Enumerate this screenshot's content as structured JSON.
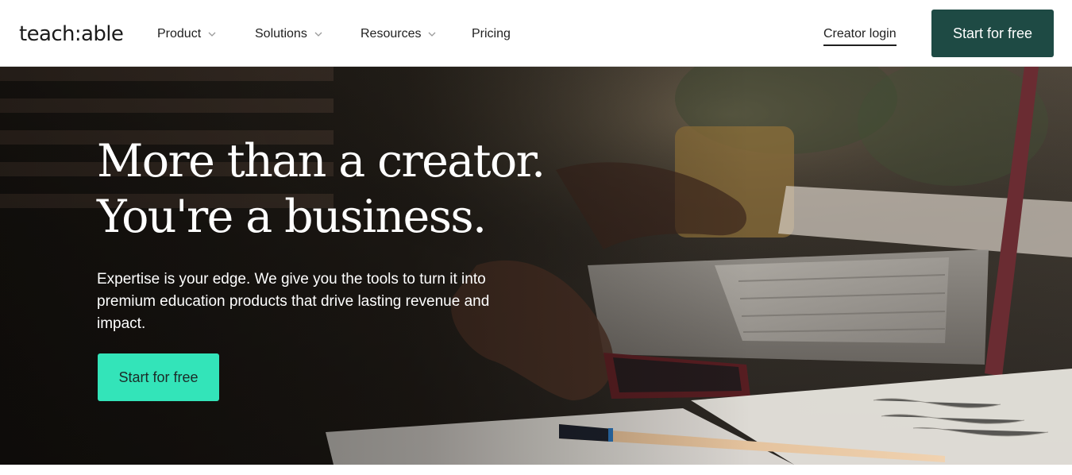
{
  "header": {
    "logo_text": "teach:able",
    "nav": [
      {
        "label": "Product",
        "has_dropdown": true
      },
      {
        "label": "Solutions",
        "has_dropdown": true
      },
      {
        "label": "Resources",
        "has_dropdown": true
      },
      {
        "label": "Pricing",
        "has_dropdown": false
      }
    ],
    "creator_login_label": "Creator login",
    "cta_label": "Start for free"
  },
  "hero": {
    "headline_line1": "More than a creator.",
    "headline_line2": "You're a business.",
    "subtext": "Expertise is your edge. We give you the tools to turn it into premium education products that drive lasting revenue and impact.",
    "cta_label": "Start for free"
  },
  "icons": {
    "dropdown": "chevron-down-icon"
  },
  "colors": {
    "header_cta_bg": "#1e4a44",
    "hero_cta_bg": "#33e4b9",
    "text_dark": "#1f1f1f"
  }
}
